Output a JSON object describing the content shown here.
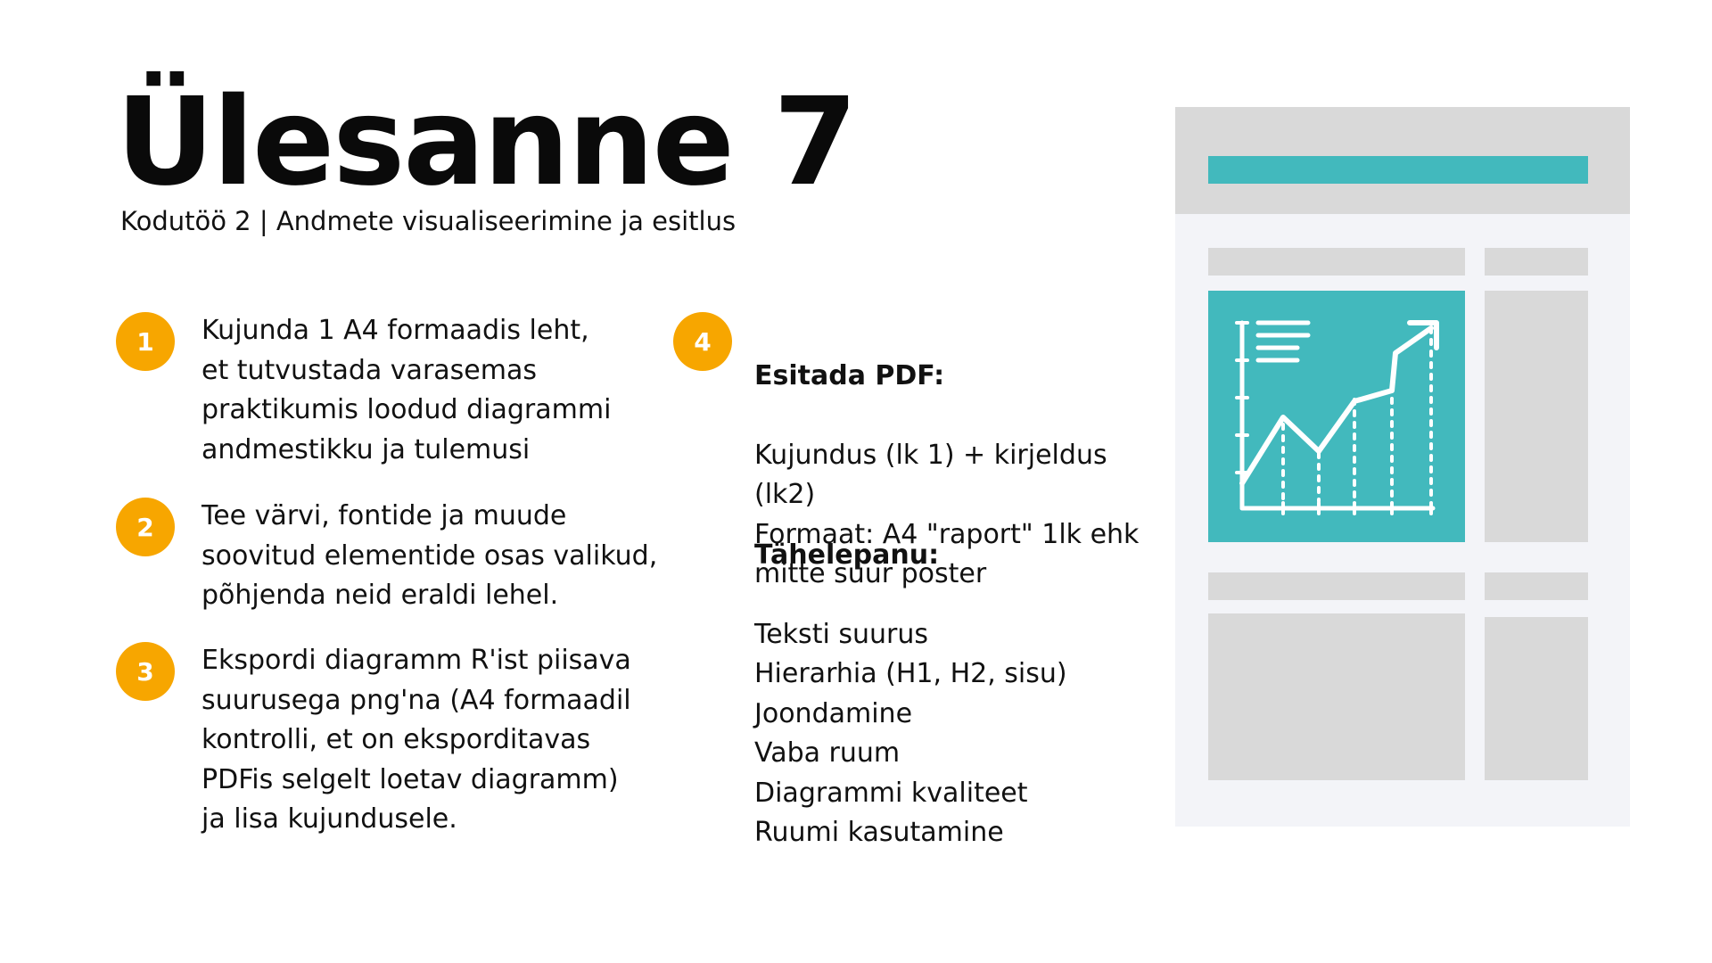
{
  "title": "Ülesanne 7",
  "subtitle": "Kodutöö 2 | Andmete visualiseerimine ja esitlus",
  "steps": [
    {
      "number": "1",
      "text": "Kujunda 1 A4 formaadis leht,\net tutvustada varasemas\npraktikumis loodud diagrammi\nandmestikku ja tulemusi"
    },
    {
      "number": "2",
      "text": "Tee värvi, fontide ja muude\nsoovitud elementide osas valikud,\npõhjenda neid eraldi lehel."
    },
    {
      "number": "3",
      "text": "Ekspordi diagramm R'ist piisava\nsuurusega png'na (A4 formaadil\nkontrolli, et on eksporditavas\nPDFis selgelt loetav diagramm)\nja lisa kujundusele."
    },
    {
      "number": "4"
    }
  ],
  "submit": {
    "heading": "Esitada PDF:",
    "lines": "Kujundus (lk 1) + kirjeldus (lk2)\nFormaat: A4 \"raport\" 1lk ehk\nmitte suur poster"
  },
  "note": {
    "heading": "Tähelepanu:",
    "lines": "Teksti suurus\nHierarhia (H1, H2, sisu)\nJoondamine\nVaba ruum\nDiagrammi kvaliteet\nRuumi kasutamine"
  },
  "colors": {
    "badge": "#f7a600",
    "teal": "#42b9bd",
    "gray": "#d9d9d9",
    "paper": "#f3f4f8"
  },
  "icons": {
    "illustration": "report-document-with-line-chart-icon"
  }
}
